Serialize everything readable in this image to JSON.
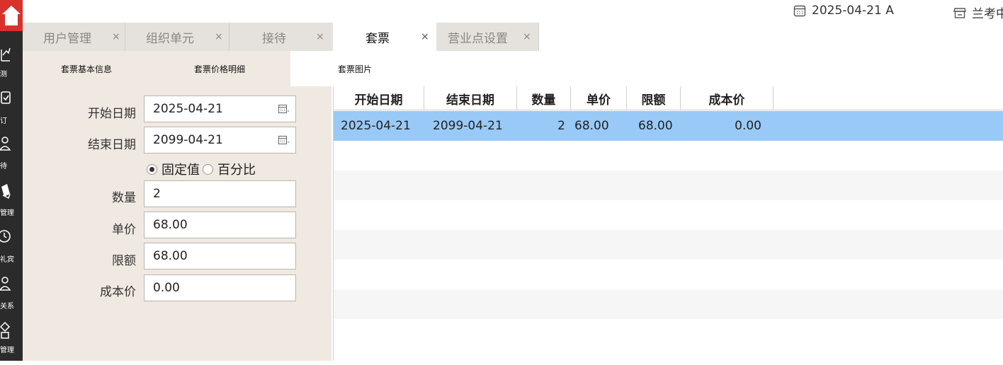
{
  "sidebar": {
    "items": [
      {
        "icon": "chart-icon",
        "label": "测"
      },
      {
        "icon": "clipboard-icon",
        "label": "订"
      },
      {
        "icon": "person-icon",
        "label": "待"
      },
      {
        "icon": "cards-icon",
        "label": "管理"
      },
      {
        "icon": "clock-icon",
        "label": "礼宾"
      },
      {
        "icon": "people-icon",
        "label": "关系"
      },
      {
        "icon": "diamond-icon",
        "label": "管理"
      }
    ]
  },
  "topbar": {
    "date": "2025-04-21 A",
    "store": "兰考中"
  },
  "tabs": [
    {
      "label": "用户管理",
      "close": "×"
    },
    {
      "label": "组织单元",
      "close": "×"
    },
    {
      "label": "接待",
      "close": "×"
    },
    {
      "label": "套票",
      "close": "×"
    },
    {
      "label": "营业点设置",
      "close": "×"
    }
  ],
  "subtabs": [
    {
      "label": "套票基本信息"
    },
    {
      "label": "套票价格明细"
    },
    {
      "label": "套票图片"
    }
  ],
  "form": {
    "start_date_label": "开始日期",
    "start_date_value": "2025-04-21",
    "end_date_label": "结束日期",
    "end_date_value": "2099-04-21",
    "radio_fixed": "固定值",
    "radio_percent": "百分比",
    "qty_label": "数量",
    "qty_value": "2",
    "price_label": "单价",
    "price_value": "68.00",
    "limit_label": "限额",
    "limit_value": "68.00",
    "cost_label": "成本价",
    "cost_value": "0.00"
  },
  "grid": {
    "columns": [
      "开始日期",
      "结束日期",
      "数量",
      "单价",
      "限额",
      "成本价"
    ],
    "rows": [
      [
        "2025-04-21",
        "2099-04-21",
        "2",
        "68.00",
        "68.00",
        "0.00"
      ]
    ]
  }
}
